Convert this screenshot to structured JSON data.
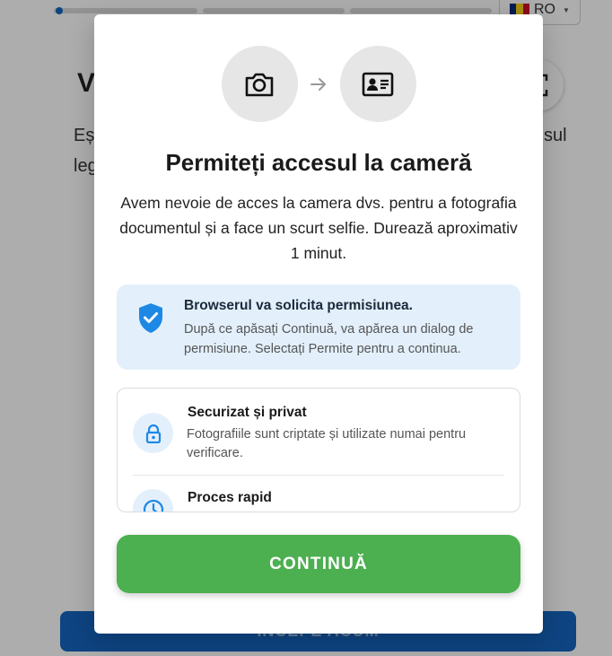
{
  "background": {
    "language": {
      "code": "RO",
      "flag_colors": [
        "#002b7f",
        "#fcd116",
        "#ce1126"
      ]
    },
    "title_fragment": "V",
    "text_line1_fragment": "Eș",
    "text_line1_end_fragment": "sul",
    "text_line2_fragment": "leg",
    "start_button_label": "ÎNCEPE ACUM"
  },
  "modal": {
    "icons": [
      "camera-icon",
      "arrow-right-icon",
      "id-card-icon"
    ],
    "title": "Permiteți accesul la cameră",
    "description": "Avem nevoie de acces la camera dvs. pentru a fotografia documentul și a face un scurt selfie. Durează aproximativ 1 minut.",
    "info": {
      "icon": "shield-check-icon",
      "title": "Browserul va solicita permisiunea.",
      "text": "După ce apăsați Continuă, va apărea un dialog de permisiune. Selectați Permite pentru a continua."
    },
    "features": [
      {
        "icon": "lock-icon",
        "title": "Securizat și privat",
        "text": "Fotografiile sunt criptate și utilizate numai pentru verificare."
      },
      {
        "icon": "clock-icon",
        "title": "Proces rapid"
      }
    ],
    "continue_label": "CONTINUĂ"
  },
  "colors": {
    "primary_blue": "#1565c0",
    "accent_green": "#4caf50",
    "info_bg": "#e3f0fc",
    "icon_blue": "#1e88e5"
  }
}
